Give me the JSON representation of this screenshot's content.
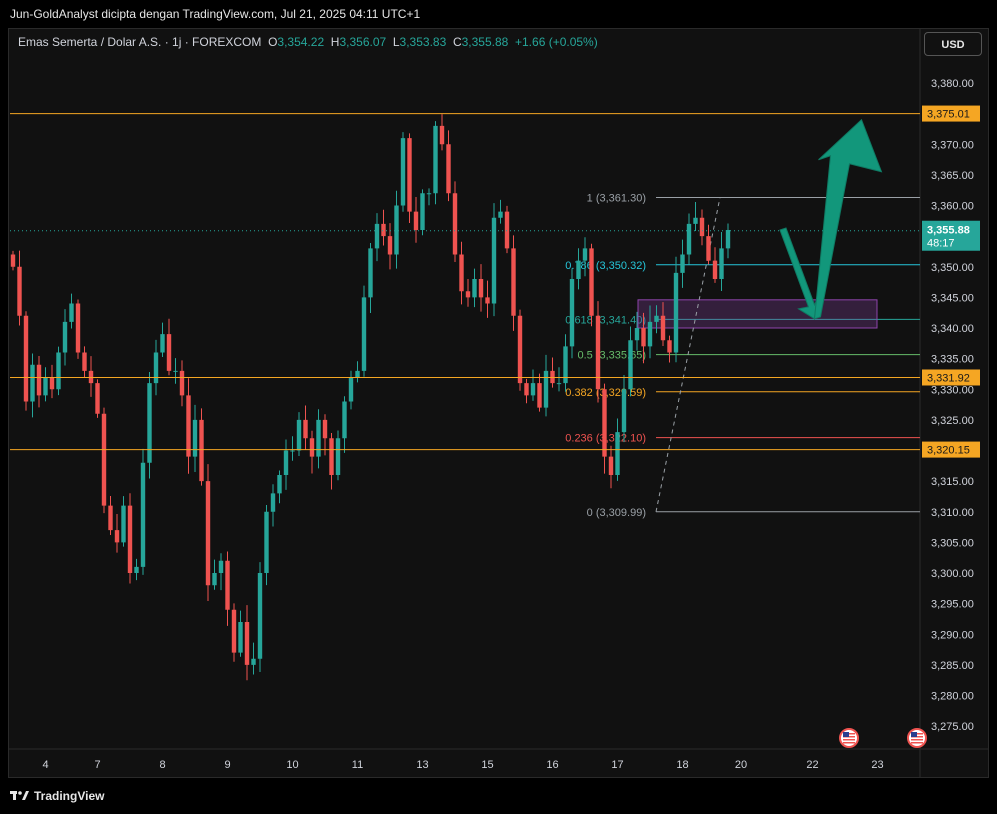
{
  "header": {
    "caption": "Jun-GoldAnalyst dicipta dengan TradingView.com, Jul 21, 2025 04:11 UTC+1"
  },
  "legend": {
    "symbol": "Emas Semerta / Dolar A.S. · 1j · FOREXCOM",
    "o_label": "O",
    "o_value": "3,354.22",
    "h_label": "H",
    "h_value": "3,356.07",
    "l_label": "L",
    "l_value": "3,353.83",
    "c_label": "C",
    "c_value": "3,355.88",
    "change": "+1.66 (+0.05%)"
  },
  "currency_button": "USD",
  "footer": {
    "brand": "TradingView"
  },
  "colors": {
    "up": "#26a69a",
    "down": "#ef5350",
    "level": "#f5a623",
    "arrow": "#12977b",
    "zone": "#8e44ad"
  },
  "chart_data": {
    "type": "candlestick",
    "ylim": [
      3272,
      3384
    ],
    "y_ticks": [
      "3,380.00",
      "3,375.00",
      "3,370.00",
      "3,365.00",
      "3,360.00",
      "3,355.00",
      "3,350.00",
      "3,345.00",
      "3,340.00",
      "3,335.00",
      "3,330.00",
      "3,325.00",
      "3,320.00",
      "3,315.00",
      "3,310.00",
      "3,305.00",
      "3,300.00",
      "3,295.00",
      "3,290.00",
      "3,285.00",
      "3,280.00",
      "3,275.00"
    ],
    "y_tick_values": [
      3380,
      3375,
      3370,
      3365,
      3360,
      3355,
      3350,
      3345,
      3340,
      3335,
      3330,
      3325,
      3320,
      3315,
      3310,
      3305,
      3300,
      3295,
      3290,
      3285,
      3280,
      3275
    ],
    "x_ticks": [
      "4",
      "7",
      "8",
      "9",
      "10",
      "11",
      "13",
      "15",
      "16",
      "17",
      "18",
      "20",
      "22",
      "23"
    ],
    "x_tick_positions_index": [
      5,
      13,
      23,
      33,
      43,
      53,
      63,
      73,
      83,
      93,
      103,
      112,
      123,
      133
    ],
    "current_price": {
      "value": 3355.88,
      "label": "3,355.88",
      "countdown": "48:17"
    },
    "horizontal_levels": [
      {
        "value": 3375.01,
        "label": "3,375.01"
      },
      {
        "value": 3331.92,
        "label": "3,331.92"
      },
      {
        "value": 3320.15,
        "label": "3,320.15"
      }
    ],
    "fibonacci": [
      {
        "ratio_label": "1 (3,361.30)",
        "value": 3361.3,
        "color": "#9aa0a6"
      },
      {
        "ratio_label": "0.786 (3,350.32)",
        "value": 3350.32,
        "color": "#26c6da"
      },
      {
        "ratio_label": "0.618 (3,341.40)",
        "value": 3341.4,
        "color": "#26a69a"
      },
      {
        "ratio_label": "0.5 (3,335.65)",
        "value": 3335.65,
        "color": "#66bb6a"
      },
      {
        "ratio_label": "0.382 (3,329.59)",
        "value": 3329.59,
        "color": "#f5a623"
      },
      {
        "ratio_label": "0.236 (3,322.10)",
        "value": 3322.1,
        "color": "#ef5350"
      },
      {
        "ratio_label": "0 (3,309.99)",
        "value": 3309.99,
        "color": "#9aa0a6"
      }
    ],
    "zone": {
      "top": 3344.6,
      "bottom": 3340.0
    },
    "projection": [
      {
        "x_index": 118,
        "y": 3356
      },
      {
        "x_index": 123,
        "y": 3341.5
      },
      {
        "x_index": 131,
        "y": 3374
      }
    ],
    "candles_close": [
      3350,
      3342,
      3328,
      3334,
      3329,
      3332,
      3330,
      3336,
      3341,
      3344,
      3336,
      3333,
      3331,
      3326,
      3311,
      3307,
      3305,
      3311,
      3300,
      3301,
      3318,
      3331,
      3336,
      3339,
      3333,
      3333,
      3329,
      3319,
      3325,
      3315,
      3298,
      3300,
      3302,
      3294,
      3287,
      3292,
      3285,
      3286,
      3300,
      3310,
      3313,
      3316,
      3320,
      3320,
      3325,
      3322,
      3319,
      3325,
      3322,
      3316,
      3322,
      3328,
      3332,
      3333,
      3345,
      3353,
      3357,
      3355,
      3352,
      3360,
      3371,
      3359,
      3356,
      3362,
      3362,
      3373,
      3370,
      3362,
      3352,
      3346,
      3345,
      3348,
      3345,
      3344,
      3358,
      3359,
      3353,
      3342,
      3331,
      3329,
      3331,
      3327,
      3333,
      3331,
      3331,
      3337,
      3348,
      3351,
      3353,
      3342,
      3330,
      3319,
      3316,
      3323,
      3330,
      3338,
      3340,
      3337,
      3341,
      3342,
      3338,
      3336,
      3349,
      3352,
      3357,
      3358,
      3355,
      3351,
      3348,
      3353,
      3356
    ]
  }
}
